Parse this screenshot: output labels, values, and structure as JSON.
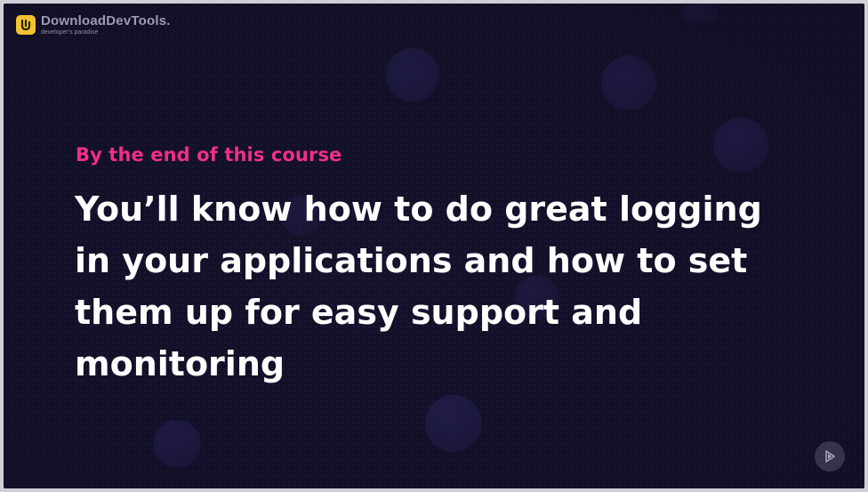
{
  "logo": {
    "name": "DownloadDevTools.",
    "tagline": "developer's paradise",
    "accent_color": "#f2c230"
  },
  "slide": {
    "eyebrow": "By the end of this course",
    "headline_lines": [
      "You’ll know how to do great logging",
      "in your applications and how to set",
      "them up for easy support and",
      "monitoring"
    ],
    "background_color": "#14112b",
    "eyebrow_color": "#ef2f88",
    "headline_color": "#ffffff"
  },
  "controls": {
    "play_icon": "play-icon"
  }
}
